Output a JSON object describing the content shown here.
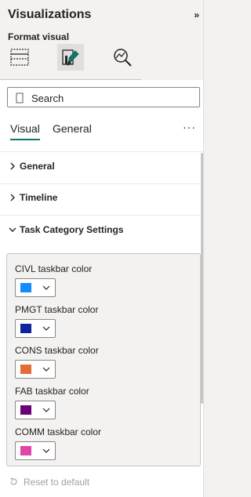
{
  "pane": {
    "title": "Visualizations",
    "subtitle": "Format visual",
    "collapse_glyph": "»",
    "tab_icons": [
      "table-fields-icon",
      "paint-brush-format-icon",
      "analytics-magnifier-icon"
    ]
  },
  "search": {
    "placeholder": "Search",
    "value": ""
  },
  "tabs": {
    "visual": "Visual",
    "general": "General",
    "more": "···"
  },
  "sections": [
    {
      "label": "General",
      "expanded": false
    },
    {
      "label": "Timeline",
      "expanded": false
    },
    {
      "label": "Task Category Settings",
      "expanded": true
    }
  ],
  "colors": [
    {
      "label": "CIVL taskbar color",
      "swatch": "#118DFF"
    },
    {
      "label": "PMGT taskbar color",
      "swatch": "#12239E"
    },
    {
      "label": "CONS taskbar color",
      "swatch": "#E66C37"
    },
    {
      "label": "FAB taskbar color",
      "swatch": "#6B007B"
    },
    {
      "label": "COMM taskbar color",
      "swatch": "#E044A7"
    }
  ],
  "reset": "Reset to default",
  "theme": {
    "accent": "#117865",
    "pane_bg": "#F3F2F1"
  }
}
